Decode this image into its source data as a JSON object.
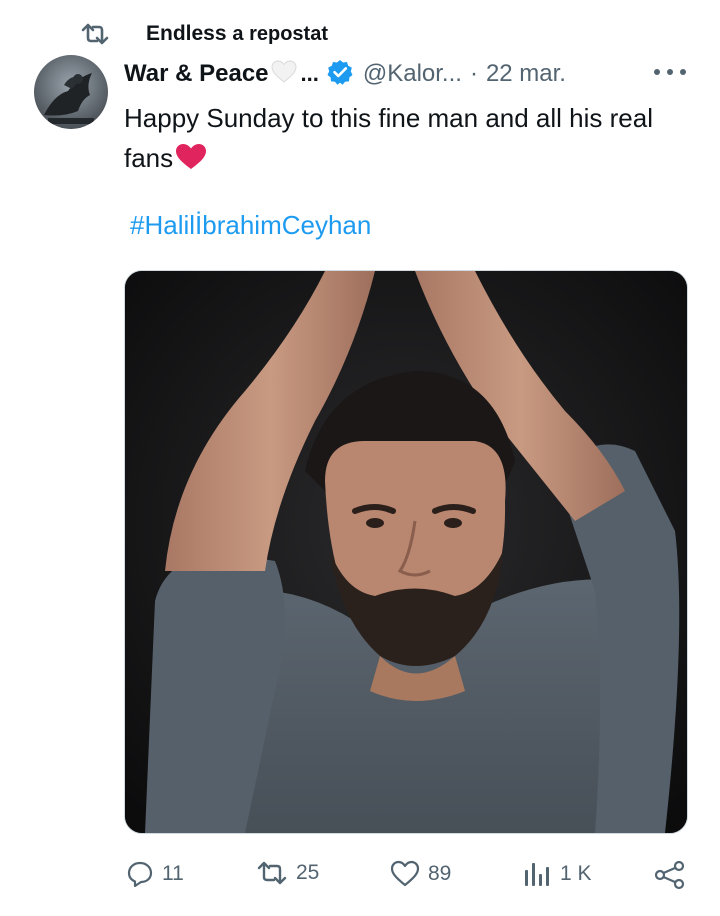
{
  "repost": {
    "icon": "repost-icon",
    "user": "Endless",
    "label": "a repostat"
  },
  "tweet": {
    "author_name": "War & Peace",
    "name_ellipsis": "...",
    "handle": "@Kalor...",
    "separator": "·",
    "date": "22 mar.",
    "text": "Happy Sunday to this fine man and all his real fans",
    "hashtag": "#HalilİbrahimCeyhan",
    "media_alt": "Portrait of a bearded man in a grey sweater with arms raised against a dark background"
  },
  "actions": {
    "replies": "11",
    "reposts": "25",
    "likes": "89",
    "views": "1 K"
  },
  "colors": {
    "link": "#1d9bf0",
    "verified": "#1d9bf0",
    "secondary": "#536471",
    "heart": "#e0245e"
  }
}
